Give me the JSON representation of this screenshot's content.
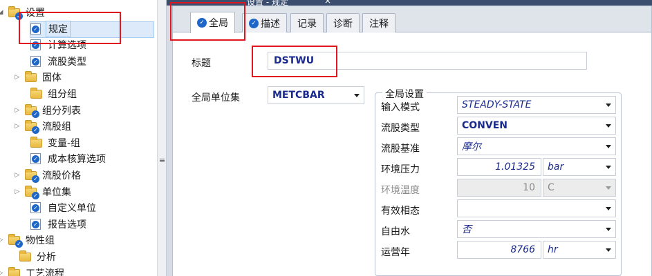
{
  "tree": {
    "items": [
      {
        "label": "设置",
        "icon": "folder-check-icon",
        "expand": "expanded"
      },
      {
        "label": "规定",
        "icon": "form-check-icon",
        "expand": "none",
        "selected": true
      },
      {
        "label": "计算选项",
        "icon": "form-check-icon",
        "expand": "none"
      },
      {
        "label": "流股类型",
        "icon": "form-check-icon",
        "expand": "none"
      },
      {
        "label": "固体",
        "icon": "folder-icon",
        "expand": "collapsed"
      },
      {
        "label": "组分组",
        "icon": "folder-icon",
        "expand": "none"
      },
      {
        "label": "组分列表",
        "icon": "folder-check-icon",
        "expand": "collapsed"
      },
      {
        "label": "流股组",
        "icon": "folder-check-icon",
        "expand": "collapsed"
      },
      {
        "label": "变量-组",
        "icon": "folder-icon",
        "expand": "none"
      },
      {
        "label": "成本核算选项",
        "icon": "form-check-icon",
        "expand": "none"
      },
      {
        "label": "流股价格",
        "icon": "folder-check-icon",
        "expand": "collapsed"
      },
      {
        "label": "单位集",
        "icon": "folder-check-icon",
        "expand": "collapsed"
      },
      {
        "label": "自定义单位",
        "icon": "form-check-icon",
        "expand": "none"
      },
      {
        "label": "报告选项",
        "icon": "form-check-icon",
        "expand": "none"
      },
      {
        "label": "物性组",
        "icon": "folder-check-icon",
        "expand": "collapsed"
      },
      {
        "label": "分析",
        "icon": "folder-icon",
        "expand": "none"
      },
      {
        "label": "工艺流程",
        "icon": "folder-icon",
        "expand": "collapsed"
      }
    ]
  },
  "doc_tab": {
    "label": "设置 - 规定",
    "close": "×"
  },
  "tabs": [
    {
      "label": "全局",
      "has_check": true,
      "active": true
    },
    {
      "label": "描述",
      "has_check": true,
      "active": false
    },
    {
      "label": "记录",
      "has_check": false,
      "active": false
    },
    {
      "label": "诊断",
      "has_check": false,
      "active": false
    },
    {
      "label": "注释",
      "has_check": false,
      "active": false
    }
  ],
  "form": {
    "title_label": "标题",
    "title_value": "DSTWU",
    "global_unit_label": "全局单位集",
    "global_unit_value": "METCBAR",
    "group_title": "全局设置",
    "rows": {
      "input_mode": {
        "label": "输入模式",
        "value": "STEADY-STATE"
      },
      "stream_type": {
        "label": "流股类型",
        "value": "CONVEN"
      },
      "flow_basis": {
        "label": "流股基准",
        "value": "摩尔"
      },
      "amb_pressure": {
        "label": "环境压力",
        "value": "1.01325",
        "unit": "bar"
      },
      "amb_temperature": {
        "label": "环境温度",
        "value": "10",
        "unit": "C"
      },
      "valid_phases": {
        "label": "有效相态",
        "value": ""
      },
      "free_water": {
        "label": "自由水",
        "value": "否"
      },
      "operating_year": {
        "label": "运营年",
        "value": "8766",
        "unit": "hr"
      }
    }
  },
  "colors": {
    "selection": "#dceaf9",
    "value_text": "#1a2a8c",
    "annotation_red": "#e0161e",
    "check_blue": "#1f66c9"
  }
}
